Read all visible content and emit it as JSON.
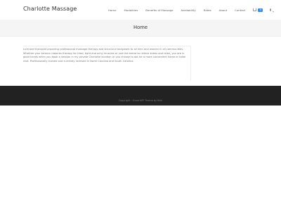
{
  "site": {
    "title": "Charlotte Massage"
  },
  "nav": {
    "items": [
      {
        "label": "Home"
      },
      {
        "label": "Modalities"
      },
      {
        "label": "Benefits of Massage"
      },
      {
        "label": "Availability"
      },
      {
        "label": "Rates"
      },
      {
        "label": "About"
      },
      {
        "label": "Contact"
      }
    ],
    "cart_count": "0",
    "icons": {
      "cart": "cart-icon",
      "search": "search-icon"
    }
  },
  "page": {
    "title": "Home",
    "body": "Licensed therapist providing professional massage therapy and structural bodywork to all men and women in all communities. Whether your tension requires therapy for tired, tight and achy muscles or just the desire to relieve stress and relax, you are in good hands when you book a session in my private Charlotte location or you choose to opt for a more convenient home or hotel visit. Professionally trained and currently licensed in North Carolina and South Carolina."
  },
  "footer": {
    "copyright": "Copyright - OceanWP Theme by Nick"
  },
  "colors": {
    "accent": "#2e8ef5",
    "footer_bg": "#222222",
    "page_header_bg": "#f5f5f5"
  }
}
